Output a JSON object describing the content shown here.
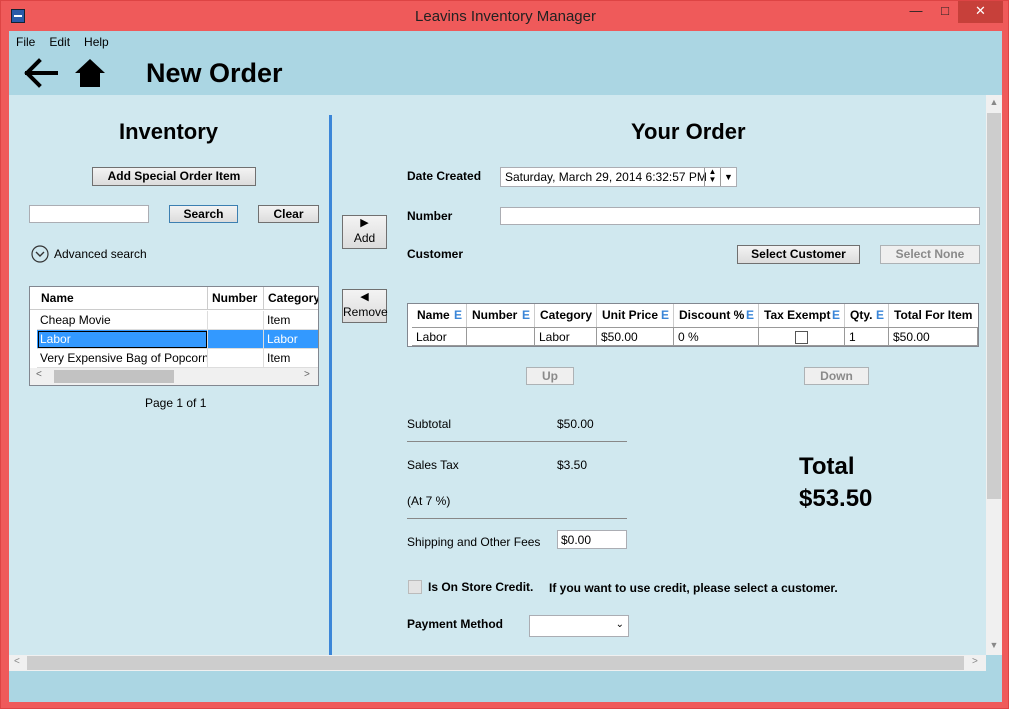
{
  "window": {
    "title": "Leavins Inventory Manager",
    "minimize": "—",
    "maximize": "□",
    "close": "✕"
  },
  "menu": [
    "File",
    "Edit",
    "Help"
  ],
  "header": {
    "title": "New Order"
  },
  "inventory": {
    "heading": "Inventory",
    "add_special_label": "Add Special Order Item",
    "search_value": "",
    "search_label": "Search",
    "clear_label": "Clear",
    "advanced_search_label": "Advanced search",
    "columns": [
      "Name",
      "Number",
      "Category"
    ],
    "rows": [
      {
        "name": "Cheap Movie",
        "number": "",
        "category": "Item"
      },
      {
        "name": "Labor",
        "number": "",
        "category": "Labor"
      },
      {
        "name": "Very Expensive Bag of Popcorn",
        "number": "",
        "category": "Item"
      }
    ],
    "page_text": "Page 1 of 1"
  },
  "transfer": {
    "add_label": "Add",
    "remove_label": "Remove",
    "add_arrow": "▶",
    "remove_arrow": "◀"
  },
  "order": {
    "heading": "Your Order",
    "date_created_label": "Date Created",
    "date_created_value": "Saturday, March 29, 2014 6:32:57 PM",
    "number_label": "Number",
    "number_value": "",
    "customer_label": "Customer",
    "select_customer_label": "Select Customer",
    "select_none_label": "Select None",
    "columns": [
      {
        "label": "Name",
        "editable": "E"
      },
      {
        "label": "Number",
        "editable": "E"
      },
      {
        "label": "Category",
        "editable": ""
      },
      {
        "label": "Unit Price",
        "editable": "E"
      },
      {
        "label": "Discount %",
        "editable": "E"
      },
      {
        "label": "Tax Exempt",
        "editable": "E"
      },
      {
        "label": "Qty.",
        "editable": "E"
      },
      {
        "label": "Total For Item",
        "editable": ""
      }
    ],
    "rows": [
      {
        "name": "Labor",
        "number": "",
        "category": "Labor",
        "unit_price": "$50.00",
        "discount": "0 %",
        "tax_exempt": false,
        "qty": "1",
        "total": "$50.00"
      }
    ],
    "up_label": "Up",
    "down_label": "Down",
    "subtotal_label": "Subtotal",
    "subtotal_value": "$50.00",
    "sales_tax_label": "Sales Tax",
    "sales_tax_value": "$3.50",
    "tax_rate_label": "(At 7 %)",
    "shipping_label": "Shipping and Other Fees",
    "shipping_value": "$0.00",
    "store_credit_label": "Is On Store Credit.",
    "store_credit_note": "If you want to use credit, please select a customer.",
    "payment_method_label": "Payment Method",
    "payment_method_value": "",
    "total_label": "Total",
    "total_value": "$53.50"
  },
  "colors": {
    "accent": "#3b86d8",
    "titlebar": "#ef5a5a",
    "client": "#abd6e3",
    "content": "#d0e8ef",
    "selection": "#3399ff"
  }
}
